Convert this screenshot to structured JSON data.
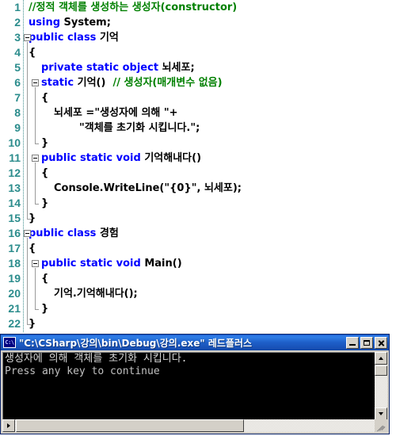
{
  "editor": {
    "name": "code-editor",
    "language": "C#",
    "colors": {
      "keyword": "#0000FF",
      "comment": "#008000",
      "text": "#000000",
      "line_number": "#2B8C8C",
      "background": "#FFFFFF"
    },
    "lines": [
      {
        "n": "1",
        "indent": 0,
        "fold": "none",
        "segments": [
          {
            "t": "//정적 객체를 생성하는 생성자(constructor)",
            "c": "cmt"
          }
        ]
      },
      {
        "n": "2",
        "indent": 0,
        "fold": "none",
        "segments": [
          {
            "t": "using ",
            "c": "kw"
          },
          {
            "t": "System;",
            "c": "plain"
          }
        ]
      },
      {
        "n": "3",
        "indent": 0,
        "fold": "open",
        "segments": [
          {
            "t": "public class ",
            "c": "kw"
          },
          {
            "t": "기억",
            "c": "plain"
          }
        ]
      },
      {
        "n": "4",
        "indent": 0,
        "fold": "none",
        "segments": [
          {
            "t": "{",
            "c": "plain"
          }
        ]
      },
      {
        "n": "5",
        "indent": 1,
        "fold": "none",
        "segments": [
          {
            "t": "private static object ",
            "c": "kw"
          },
          {
            "t": "뇌세포;",
            "c": "plain"
          }
        ]
      },
      {
        "n": "6",
        "indent": 1,
        "fold": "open",
        "segments": [
          {
            "t": "static ",
            "c": "kw"
          },
          {
            "t": "기억()  ",
            "c": "plain"
          },
          {
            "t": "// 생성자(매개변수 없음)",
            "c": "cmt"
          }
        ]
      },
      {
        "n": "7",
        "indent": 1,
        "fold": "none",
        "segments": [
          {
            "t": "{",
            "c": "plain"
          }
        ]
      },
      {
        "n": "8",
        "indent": 2,
        "fold": "none",
        "segments": [
          {
            "t": "뇌세포 =",
            "c": "plain"
          },
          {
            "t": "\"생성자에 의해 \"",
            "c": "str"
          },
          {
            "t": "+",
            "c": "plain"
          }
        ]
      },
      {
        "n": "9",
        "indent": 4,
        "fold": "none",
        "segments": [
          {
            "t": "\"객체를 초기화 시킵니다.\"",
            "c": "str"
          },
          {
            "t": ";",
            "c": "plain"
          }
        ]
      },
      {
        "n": "10",
        "indent": 1,
        "fold": "end",
        "segments": [
          {
            "t": "}",
            "c": "plain"
          }
        ]
      },
      {
        "n": "11",
        "indent": 1,
        "fold": "open",
        "segments": [
          {
            "t": "public static void ",
            "c": "kw"
          },
          {
            "t": "기억해내다()",
            "c": "plain"
          }
        ]
      },
      {
        "n": "12",
        "indent": 1,
        "fold": "none",
        "segments": [
          {
            "t": "{",
            "c": "plain"
          }
        ]
      },
      {
        "n": "13",
        "indent": 2,
        "fold": "none",
        "segments": [
          {
            "t": "Console.WriteLine(",
            "c": "plain"
          },
          {
            "t": "\"{0}\"",
            "c": "str"
          },
          {
            "t": ", 뇌세포);",
            "c": "plain"
          }
        ]
      },
      {
        "n": "14",
        "indent": 1,
        "fold": "end",
        "segments": [
          {
            "t": "}",
            "c": "plain"
          }
        ]
      },
      {
        "n": "15",
        "indent": 0,
        "fold": "end",
        "segments": [
          {
            "t": "}",
            "c": "plain"
          }
        ]
      },
      {
        "n": "16",
        "indent": 0,
        "fold": "open",
        "segments": [
          {
            "t": "public class ",
            "c": "kw"
          },
          {
            "t": "경험",
            "c": "plain"
          }
        ]
      },
      {
        "n": "17",
        "indent": 0,
        "fold": "none",
        "segments": [
          {
            "t": "{",
            "c": "plain"
          }
        ]
      },
      {
        "n": "18",
        "indent": 1,
        "fold": "open",
        "segments": [
          {
            "t": "public static void ",
            "c": "kw"
          },
          {
            "t": "Main()",
            "c": "plain"
          }
        ]
      },
      {
        "n": "19",
        "indent": 1,
        "fold": "none",
        "segments": [
          {
            "t": "{",
            "c": "plain"
          }
        ]
      },
      {
        "n": "20",
        "indent": 2,
        "fold": "none",
        "segments": [
          {
            "t": "기억.기억해내다();",
            "c": "plain"
          }
        ]
      },
      {
        "n": "21",
        "indent": 1,
        "fold": "end",
        "segments": [
          {
            "t": "}",
            "c": "plain"
          }
        ]
      },
      {
        "n": "22",
        "indent": 0,
        "fold": "end",
        "segments": [
          {
            "t": "}",
            "c": "plain"
          }
        ]
      }
    ]
  },
  "console": {
    "title": "\"C:\\CSharp\\강의\\bin\\Debug\\강의.exe\" 레드플러스",
    "icon": "command-prompt-icon",
    "title_bar_color": "#1E5FC8",
    "background": "#000000",
    "output": [
      "생성자에 의해 객체를 초기화 시킵니다.",
      "Press any key to continue"
    ],
    "buttons": {
      "minimize": "minimize-button",
      "maximize": "maximize-button",
      "close": "close-button"
    },
    "scrollbars": {
      "vertical": {
        "thumb_position_pct": 0,
        "thumb_size_pct": 25
      },
      "horizontal": {
        "thumb_position_pct": 0,
        "thumb_size_pct": 65
      }
    }
  }
}
